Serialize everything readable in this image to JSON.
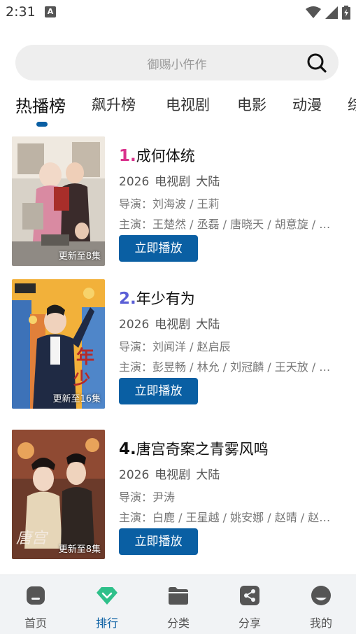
{
  "status_bar": {
    "time": "2:31",
    "notification_icon": "A"
  },
  "search": {
    "placeholder": "御赐小仵作"
  },
  "tabs": [
    {
      "label": "热播榜",
      "active": true
    },
    {
      "label": "飙升榜"
    },
    {
      "label": "电视剧"
    },
    {
      "label": "电影"
    },
    {
      "label": "动漫"
    },
    {
      "label": "综"
    }
  ],
  "items": [
    {
      "rank": "1.",
      "rank_color": "#d9318c",
      "title": "成何体统",
      "year": "2026",
      "type": "电视剧",
      "region": "大陆",
      "director": "导演：刘海波 / 王莉",
      "cast": "主演：王楚然 / 丞磊 / 唐晓天 / 胡意旋 / 王伯翰",
      "badge": "更新至8集",
      "button": "立即播放"
    },
    {
      "rank": "2.",
      "rank_color": "#5b5fd6",
      "title": "年少有为",
      "year": "2026",
      "type": "电视剧",
      "region": "大陆",
      "director": "导演：刘闻洋 / 赵启辰",
      "cast": "主演：彭昱畅 / 林允 / 刘冠麟 / 王天放 / 张晚意",
      "badge": "更新至16集",
      "button": "立即播放"
    },
    {
      "rank": "4.",
      "rank_color": "#111111",
      "title": "唐宫奇案之青雾风鸣",
      "year": "2026",
      "type": "电视剧",
      "region": "大陆",
      "director": "导演：尹涛",
      "cast": "主演：白鹿 / 王星越 / 姚安娜 / 赵晴 / 赵昭仪",
      "badge": "更新至8集",
      "button": "立即播放"
    }
  ],
  "bottom_nav": [
    {
      "label": "首页",
      "icon": "home-icon"
    },
    {
      "label": "排行",
      "icon": "ranking-icon",
      "active": true
    },
    {
      "label": "分类",
      "icon": "folder-icon"
    },
    {
      "label": "分享",
      "icon": "share-icon"
    },
    {
      "label": "我的",
      "icon": "profile-icon"
    }
  ],
  "colors": {
    "accent": "#0a5fa3",
    "rank_active_icon": "#2fc08a"
  }
}
